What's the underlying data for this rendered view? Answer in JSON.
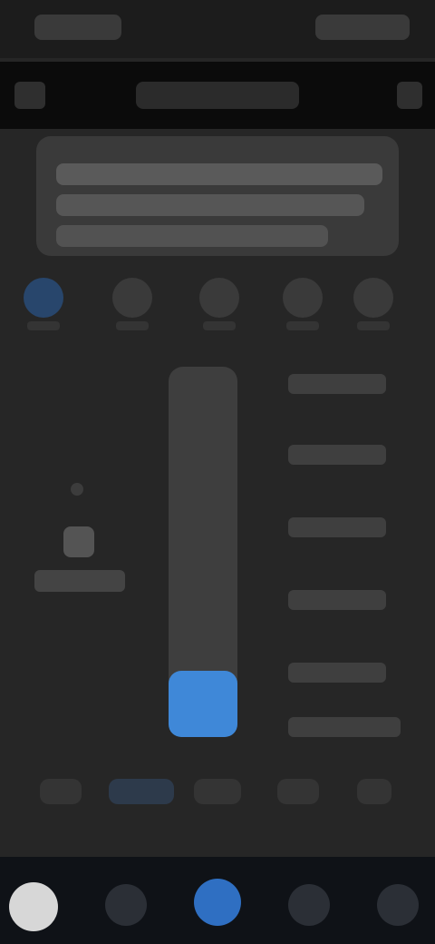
{
  "ui_state": {
    "blurred": true,
    "app_mode_count": 5,
    "active_mode_index": 0,
    "slider_level_fraction": 0.18,
    "preset_count": 6,
    "quick_actions_count": 5
  },
  "colors": {
    "background": "#262626",
    "status_bar": "#1c1c1c",
    "app_bar": "#0b0b0b",
    "card": "#3a3a3a",
    "accent": "#3f88d8",
    "mode_active": "#28466c",
    "bottom_bar": "#0f1217",
    "avatar": "#d7d7d7"
  },
  "icons": {
    "back": "arrow-left-icon",
    "more": "more-vert-icon",
    "modes": [
      "power-icon",
      "mode-icon",
      "fan-icon",
      "temp-icon",
      "settings-icon"
    ],
    "left_panel": "sun-icon",
    "bottom_bar": [
      "avatar",
      "home-icon",
      "primary-action-icon",
      "list-icon",
      "profile-icon"
    ]
  }
}
